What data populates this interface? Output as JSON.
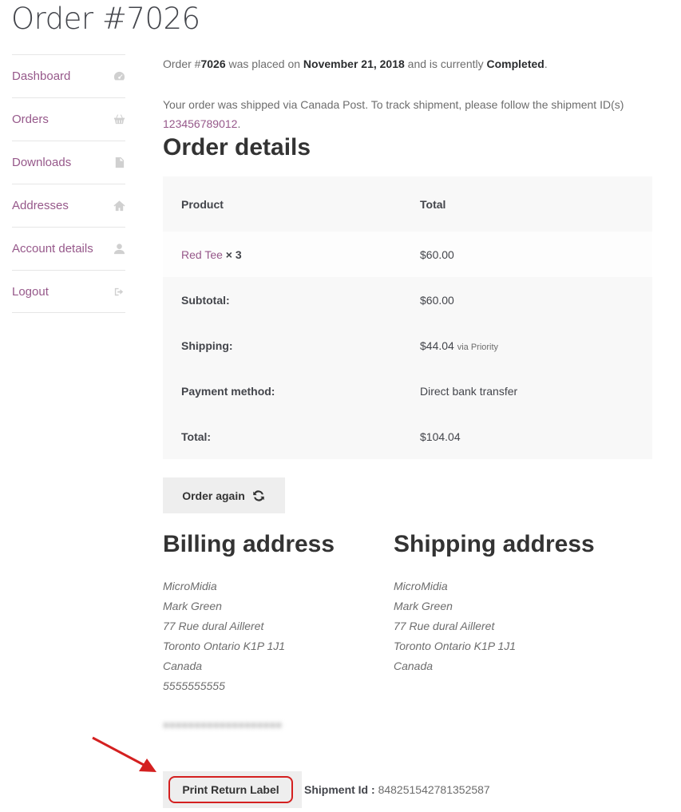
{
  "page": {
    "title": "Order #7026"
  },
  "nav": {
    "items": [
      {
        "label": "Dashboard",
        "icon": "tachometer-icon"
      },
      {
        "label": "Orders",
        "icon": "basket-icon"
      },
      {
        "label": "Downloads",
        "icon": "file-icon"
      },
      {
        "label": "Addresses",
        "icon": "home-icon"
      },
      {
        "label": "Account details",
        "icon": "user-icon"
      },
      {
        "label": "Logout",
        "icon": "sign-out-icon"
      }
    ]
  },
  "notice": {
    "prefix": "Order #",
    "order_number": "7026",
    "middle": " was placed on ",
    "date": "November 21, 2018",
    "suffix": " and is currently ",
    "status": "Completed",
    "end": "."
  },
  "shipping_info": {
    "text": "Your order was shipped via Canada Post. To track shipment, please follow the shipment ID(s) ",
    "tracking_id": "123456789012",
    "end": "."
  },
  "order_details": {
    "heading": "Order details",
    "columns": [
      "Product",
      "Total"
    ],
    "item": {
      "name": "Red Tee",
      "qty": "× 3",
      "total": "$60.00"
    },
    "totals": [
      {
        "label": "Subtotal:",
        "value": "$60.00",
        "note": ""
      },
      {
        "label": "Shipping:",
        "value": "$44.04",
        "note": "via Priority"
      },
      {
        "label": "Payment method:",
        "value": "Direct bank transfer",
        "note": ""
      },
      {
        "label": "Total:",
        "value": "$104.04",
        "note": ""
      }
    ]
  },
  "order_again": {
    "label": "Order again"
  },
  "billing": {
    "heading": "Billing address",
    "lines": [
      "MicroMidia",
      "Mark Green",
      "77 Rue dural Ailleret",
      "Toronto Ontario K1P 1J1",
      "Canada",
      "5555555555"
    ]
  },
  "shipping": {
    "heading": "Shipping address",
    "lines": [
      "MicroMidia",
      "Mark Green",
      "77 Rue dural Ailleret",
      "Toronto Ontario K1P 1J1",
      "Canada"
    ]
  },
  "return_label": {
    "button": "Print Return Label",
    "shipment_label": "Shipment Id :",
    "shipment_id": "848251542781352587"
  },
  "colors": {
    "link": "#96588a",
    "highlight": "#d42020"
  }
}
